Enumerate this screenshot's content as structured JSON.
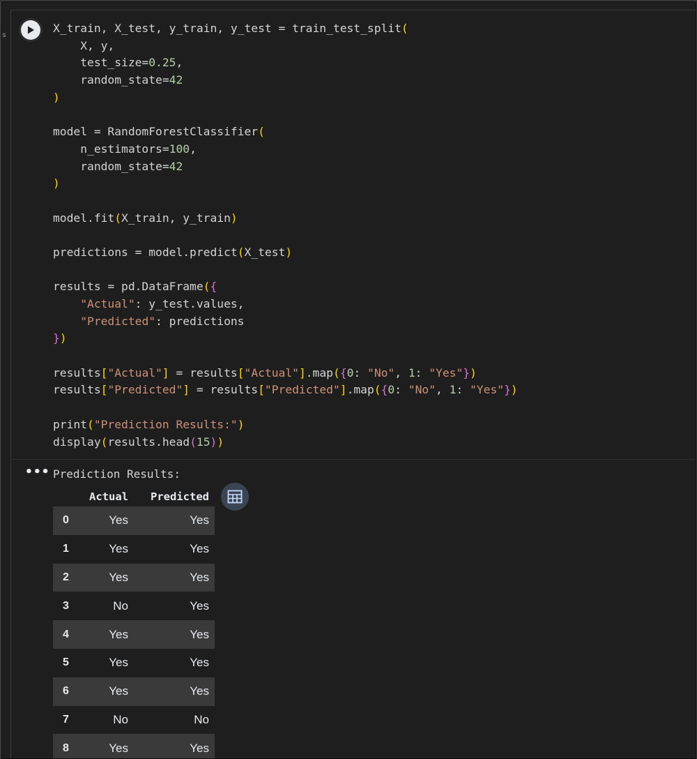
{
  "gutter_mark": "s",
  "code_lines": [
    {
      "tokens": [
        {
          "t": "X_train, X_test, y_train, y_test = train_test_split"
        },
        {
          "t": "(",
          "c": "p1"
        }
      ]
    },
    {
      "tokens": [
        {
          "t": "    X, y,"
        }
      ]
    },
    {
      "tokens": [
        {
          "t": "    test_size="
        },
        {
          "t": "0.25",
          "c": "num"
        },
        {
          "t": ","
        }
      ]
    },
    {
      "tokens": [
        {
          "t": "    random_state="
        },
        {
          "t": "42",
          "c": "num"
        }
      ]
    },
    {
      "tokens": [
        {
          "t": ")",
          "c": "p1"
        }
      ]
    },
    {
      "tokens": []
    },
    {
      "tokens": [
        {
          "t": "model = RandomForestClassifier"
        },
        {
          "t": "(",
          "c": "p1"
        }
      ]
    },
    {
      "tokens": [
        {
          "t": "    n_estimators="
        },
        {
          "t": "100",
          "c": "num"
        },
        {
          "t": ","
        }
      ]
    },
    {
      "tokens": [
        {
          "t": "    random_state="
        },
        {
          "t": "42",
          "c": "num"
        }
      ]
    },
    {
      "tokens": [
        {
          "t": ")",
          "c": "p1"
        }
      ]
    },
    {
      "tokens": []
    },
    {
      "tokens": [
        {
          "t": "model.fit"
        },
        {
          "t": "(",
          "c": "p1"
        },
        {
          "t": "X_train, y_train"
        },
        {
          "t": ")",
          "c": "p1"
        }
      ]
    },
    {
      "tokens": []
    },
    {
      "tokens": [
        {
          "t": "predictions = model.predict"
        },
        {
          "t": "(",
          "c": "p1"
        },
        {
          "t": "X_test"
        },
        {
          "t": ")",
          "c": "p1"
        }
      ]
    },
    {
      "tokens": []
    },
    {
      "tokens": [
        {
          "t": "results = pd.DataFrame"
        },
        {
          "t": "(",
          "c": "p1"
        },
        {
          "t": "{",
          "c": "p2"
        }
      ]
    },
    {
      "tokens": [
        {
          "t": "    "
        },
        {
          "t": "\"Actual\"",
          "c": "str"
        },
        {
          "t": ": y_test.values,"
        }
      ]
    },
    {
      "tokens": [
        {
          "t": "    "
        },
        {
          "t": "\"Predicted\"",
          "c": "str"
        },
        {
          "t": ": predictions"
        }
      ]
    },
    {
      "tokens": [
        {
          "t": "}",
          "c": "p2"
        },
        {
          "t": ")",
          "c": "p1"
        }
      ]
    },
    {
      "tokens": []
    },
    {
      "tokens": [
        {
          "t": "results"
        },
        {
          "t": "[",
          "c": "p1"
        },
        {
          "t": "\"Actual\"",
          "c": "str"
        },
        {
          "t": "]",
          "c": "p1"
        },
        {
          "t": " = results"
        },
        {
          "t": "[",
          "c": "p1"
        },
        {
          "t": "\"Actual\"",
          "c": "str"
        },
        {
          "t": "]",
          "c": "p1"
        },
        {
          "t": ".map"
        },
        {
          "t": "(",
          "c": "p1"
        },
        {
          "t": "{",
          "c": "p2"
        },
        {
          "t": "0",
          "c": "num"
        },
        {
          "t": ": "
        },
        {
          "t": "\"No\"",
          "c": "str"
        },
        {
          "t": ", "
        },
        {
          "t": "1",
          "c": "num"
        },
        {
          "t": ": "
        },
        {
          "t": "\"Yes\"",
          "c": "str"
        },
        {
          "t": "}",
          "c": "p2"
        },
        {
          "t": ")",
          "c": "p1"
        }
      ]
    },
    {
      "tokens": [
        {
          "t": "results"
        },
        {
          "t": "[",
          "c": "p1"
        },
        {
          "t": "\"Predicted\"",
          "c": "str"
        },
        {
          "t": "]",
          "c": "p1"
        },
        {
          "t": " = results"
        },
        {
          "t": "[",
          "c": "p1"
        },
        {
          "t": "\"Predicted\"",
          "c": "str"
        },
        {
          "t": "]",
          "c": "p1"
        },
        {
          "t": ".map"
        },
        {
          "t": "(",
          "c": "p1"
        },
        {
          "t": "{",
          "c": "p2"
        },
        {
          "t": "0",
          "c": "num"
        },
        {
          "t": ": "
        },
        {
          "t": "\"No\"",
          "c": "str"
        },
        {
          "t": ", "
        },
        {
          "t": "1",
          "c": "num"
        },
        {
          "t": ": "
        },
        {
          "t": "\"Yes\"",
          "c": "str"
        },
        {
          "t": "}",
          "c": "p2"
        },
        {
          "t": ")",
          "c": "p1"
        }
      ]
    },
    {
      "tokens": []
    },
    {
      "tokens": [
        {
          "t": "print"
        },
        {
          "t": "(",
          "c": "p1"
        },
        {
          "t": "\"Prediction Results:\"",
          "c": "str"
        },
        {
          "t": ")",
          "c": "p1"
        }
      ]
    },
    {
      "tokens": [
        {
          "t": "display"
        },
        {
          "t": "(",
          "c": "p1"
        },
        {
          "t": "results.head"
        },
        {
          "t": "(",
          "c": "p2"
        },
        {
          "t": "15",
          "c": "num"
        },
        {
          "t": ")",
          "c": "p2"
        },
        {
          "t": ")",
          "c": "p1"
        }
      ]
    }
  ],
  "output": {
    "menu_glyph": "•••",
    "printed_text": "Prediction Results:",
    "table": {
      "columns": [
        "Actual",
        "Predicted"
      ],
      "rows": [
        {
          "index": "0",
          "actual": "Yes",
          "predicted": "Yes"
        },
        {
          "index": "1",
          "actual": "Yes",
          "predicted": "Yes"
        },
        {
          "index": "2",
          "actual": "Yes",
          "predicted": "Yes"
        },
        {
          "index": "3",
          "actual": "No",
          "predicted": "Yes"
        },
        {
          "index": "4",
          "actual": "Yes",
          "predicted": "Yes"
        },
        {
          "index": "5",
          "actual": "Yes",
          "predicted": "Yes"
        },
        {
          "index": "6",
          "actual": "Yes",
          "predicted": "Yes"
        },
        {
          "index": "7",
          "actual": "No",
          "predicted": "No"
        },
        {
          "index": "8",
          "actual": "Yes",
          "predicted": "Yes"
        }
      ]
    }
  },
  "icons": {
    "run": "play-icon",
    "output_menu": "more-horizontal-icon",
    "table_view": "table-grid-icon"
  },
  "colors": {
    "background": "#1e1e1e",
    "string": "#ce9178",
    "number": "#b5cea8",
    "bracket_level1": "#ffd700",
    "bracket_level2": "#da70d6",
    "table_stripe": "#3a3a3a"
  }
}
